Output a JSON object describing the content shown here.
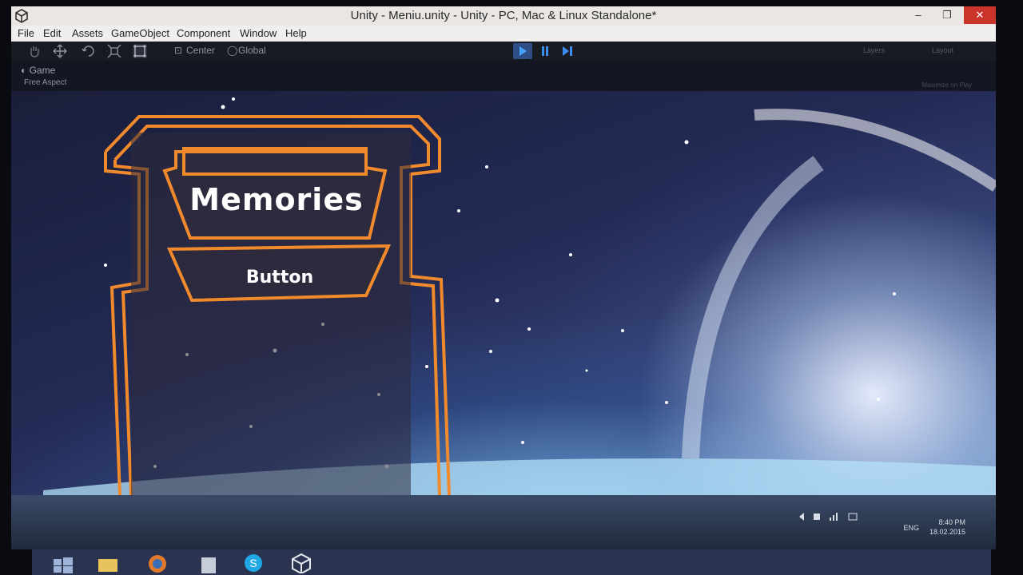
{
  "window": {
    "title": "Unity - Meniu.unity - Unity - PC, Mac & Linux Standalone*",
    "controls": {
      "minimize": "–",
      "maximize": "❐",
      "close": "✕"
    }
  },
  "menu": [
    "File",
    "Edit",
    "Assets",
    "GameObject",
    "Component",
    "Window",
    "Help"
  ],
  "toolbar": {
    "tools": [
      "hand-tool",
      "move-tool",
      "rotate-tool",
      "scale-tool",
      "rect-tool"
    ],
    "pivot_center": "Center",
    "pivot_global": "Global",
    "layers": "Layers",
    "layout": "Layout"
  },
  "game_view": {
    "tab": "Game",
    "aspect": "Free Aspect",
    "maximize_on_play": "Maximize on Play"
  },
  "scene": {
    "title": "Memories",
    "button_label": "Button",
    "frame_color": "#f08a2c",
    "panel_color": "#2e2a3d"
  },
  "taskbar": {
    "language": "ENG",
    "time": "8:40 PM",
    "date": "18.02.2015"
  }
}
